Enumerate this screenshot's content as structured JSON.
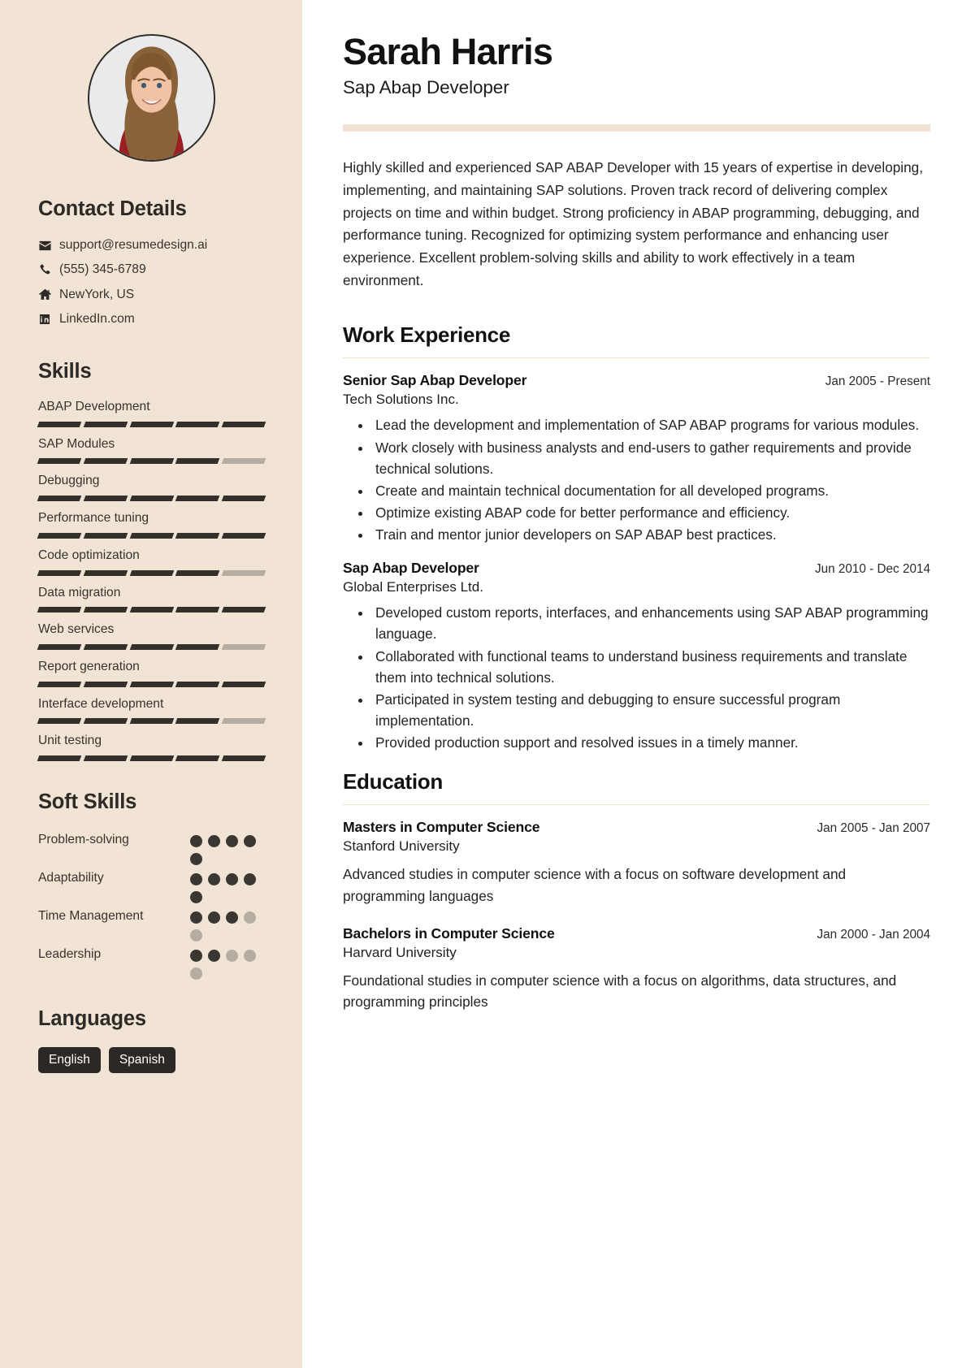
{
  "header": {
    "name": "Sarah Harris",
    "job_title": "Sap Abap Developer"
  },
  "summary": "Highly skilled and experienced SAP ABAP Developer with 15 years of expertise in developing, implementing, and maintaining SAP solutions. Proven track record of delivering complex projects on time and within budget. Strong proficiency in ABAP programming, debugging, and performance tuning. Recognized for optimizing system performance and enhancing user experience. Excellent problem-solving skills and ability to work effectively in a team environment.",
  "sidebar": {
    "avatar_alt": "profile-photo",
    "contact": {
      "heading": "Contact Details",
      "items": [
        {
          "icon": "envelope-icon",
          "value": "support@resumedesign.ai"
        },
        {
          "icon": "phone-icon",
          "value": "(555) 345-6789"
        },
        {
          "icon": "home-icon",
          "value": "NewYork, US"
        },
        {
          "icon": "linkedin-icon",
          "value": "LinkedIn.com"
        }
      ]
    },
    "skills": {
      "heading": "Skills",
      "max": 5,
      "items": [
        {
          "name": "ABAP Development",
          "level": 5
        },
        {
          "name": "SAP Modules",
          "level": 4
        },
        {
          "name": "Debugging",
          "level": 5
        },
        {
          "name": "Performance tuning",
          "level": 5
        },
        {
          "name": "Code optimization",
          "level": 4
        },
        {
          "name": "Data migration",
          "level": 5
        },
        {
          "name": "Web services",
          "level": 4
        },
        {
          "name": "Report generation",
          "level": 5
        },
        {
          "name": "Interface development",
          "level": 4
        },
        {
          "name": "Unit testing",
          "level": 5
        }
      ]
    },
    "soft_skills": {
      "heading": "Soft Skills",
      "max": 5,
      "items": [
        {
          "name": "Problem-solving",
          "level": 5
        },
        {
          "name": "Adaptability",
          "level": 5
        },
        {
          "name": "Time Management",
          "level": 3
        },
        {
          "name": "Leadership",
          "level": 2
        }
      ]
    },
    "languages": {
      "heading": "Languages",
      "items": [
        "English",
        "Spanish"
      ]
    }
  },
  "work": {
    "heading": "Work Experience",
    "entries": [
      {
        "title": "Senior Sap Abap Developer",
        "organization": "Tech Solutions Inc.",
        "date": "Jan 2005 - Present",
        "bullets": [
          "Lead the development and implementation of SAP ABAP programs for various modules.",
          "Work closely with business analysts and end-users to gather requirements and provide technical solutions.",
          "Create and maintain technical documentation for all developed programs.",
          "Optimize existing ABAP code for better performance and efficiency.",
          "Train and mentor junior developers on SAP ABAP best practices."
        ]
      },
      {
        "title": "Sap Abap Developer",
        "organization": "Global Enterprises Ltd.",
        "date": "Jun 2010 - Dec 2014",
        "bullets": [
          "Developed custom reports, interfaces, and enhancements using SAP ABAP programming language.",
          "Collaborated with functional teams to understand business requirements and translate them into technical solutions.",
          "Participated in system testing and debugging to ensure successful program implementation.",
          "Provided production support and resolved issues in a timely manner."
        ]
      }
    ]
  },
  "education": {
    "heading": "Education",
    "entries": [
      {
        "degree": "Masters in Computer Science",
        "school": "Stanford University",
        "date": "Jan 2005 - Jan 2007",
        "description": "Advanced studies in computer science with a focus on software development and programming languages"
      },
      {
        "degree": "Bachelors in Computer Science",
        "school": "Harvard University",
        "date": "Jan 2000 - Jan 2004",
        "description": "Foundational studies in computer science with a focus on algorithms, data structures, and programming principles"
      }
    ]
  },
  "colors": {
    "sidebar_bg": "#f1e4d5",
    "ink": "#2d2a27",
    "bar_on": "#33302c",
    "bar_off": "#b5ada2",
    "tag_bg": "#2b2825"
  }
}
